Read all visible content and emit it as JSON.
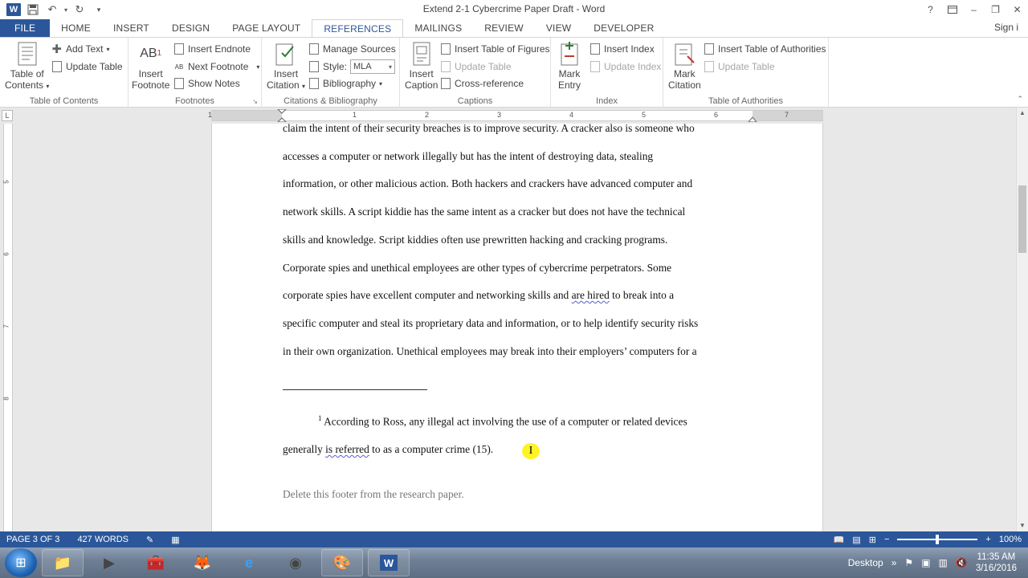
{
  "window": {
    "title": "Extend 2-1 Cybercrime Paper Draft - Word",
    "help": "?",
    "minimize": "–",
    "restore": "❐",
    "close": "✕"
  },
  "qat": {
    "app_icon": "W",
    "save_icon": "💾",
    "undo_icon": "↶",
    "redo_icon": "↻",
    "customize_icon": "▾"
  },
  "tabs": [
    "FILE",
    "HOME",
    "INSERT",
    "DESIGN",
    "PAGE LAYOUT",
    "REFERENCES",
    "MAILINGS",
    "REVIEW",
    "VIEW",
    "DEVELOPER"
  ],
  "active_tab": "REFERENCES",
  "signin": "Sign i",
  "ribbon": {
    "toc": {
      "big_label_1": "Table of",
      "big_label_2": "Contents",
      "add_text": "Add Text",
      "update_table": "Update Table",
      "group": "Table of Contents"
    },
    "footnotes": {
      "big_label_1": "Insert",
      "big_label_2": "Footnote",
      "ab_icon": "AB",
      "sup": "1",
      "insert_endnote": "Insert Endnote",
      "next_footnote": "Next Footnote",
      "show_notes": "Show Notes",
      "group": "Footnotes"
    },
    "citations": {
      "big_label_1": "Insert",
      "big_label_2": "Citation",
      "manage_sources": "Manage Sources",
      "style_label": "Style:",
      "style_value": "MLA",
      "bibliography": "Bibliography",
      "group": "Citations & Bibliography"
    },
    "captions": {
      "big_label_1": "Insert",
      "big_label_2": "Caption",
      "insert_tof": "Insert Table of Figures",
      "update_table": "Update Table",
      "cross_reference": "Cross-reference",
      "group": "Captions"
    },
    "index": {
      "big_label_1": "Mark",
      "big_label_2": "Entry",
      "insert_index": "Insert Index",
      "update_index": "Update Index",
      "group": "Index"
    },
    "toa": {
      "big_label_1": "Mark",
      "big_label_2": "Citation",
      "insert_toa": "Insert Table of Authorities",
      "update_table": "Update Table",
      "group": "Table of Authorities"
    }
  },
  "ruler": {
    "corner": "L",
    "numbers": [
      "1",
      "1",
      "2",
      "3",
      "4",
      "5",
      "6",
      "7"
    ],
    "vnumbers": [
      "5",
      "6",
      "7",
      "8"
    ]
  },
  "document": {
    "lines": [
      "claim the intent of their security breaches is to improve security. A cracker also is someone who",
      "accesses a computer or network illegally but has the intent of destroying data, stealing",
      "information, or other malicious action. Both hackers and crackers have advanced computer and",
      "network skills. A script kiddie has the same intent as a cracker but does not have the technical",
      "skills and knowledge. Script kiddies often use prewritten hacking and cracking programs.",
      "Corporate spies and unethical employees are other types of cybercrime perpetrators. Some",
      "specific computer and steal its proprietary data and information, or to help identify security risks",
      "in their own organization. Unethical employees may break into their employers’ computers for a"
    ],
    "line7_before": "corporate spies have excellent computer and networking skills and ",
    "line7_squiggle": "are hired",
    "line7_after": " to break into a",
    "footnote_number": "1",
    "footnote_line1": " According to Ross, any illegal act involving the use of a computer or related devices",
    "footnote_line2_before": "generally ",
    "footnote_line2_squiggle": "is referred",
    "footnote_line2_after": " to as a computer crime (15).",
    "cursor_glyph": "I",
    "footer_text": "Delete this footer from the research paper."
  },
  "status": {
    "page": "PAGE 3 OF 3",
    "words": "427 WORDS",
    "zoom": "100%",
    "minus": "−",
    "plus": "+"
  },
  "taskbar": {
    "desktop_label": "Desktop",
    "time": "11:35 AM",
    "date": "3/16/2016"
  },
  "colors": {
    "accent": "#2b579a",
    "squiggle": "#5b5bd6",
    "highlight": "#fff000"
  }
}
